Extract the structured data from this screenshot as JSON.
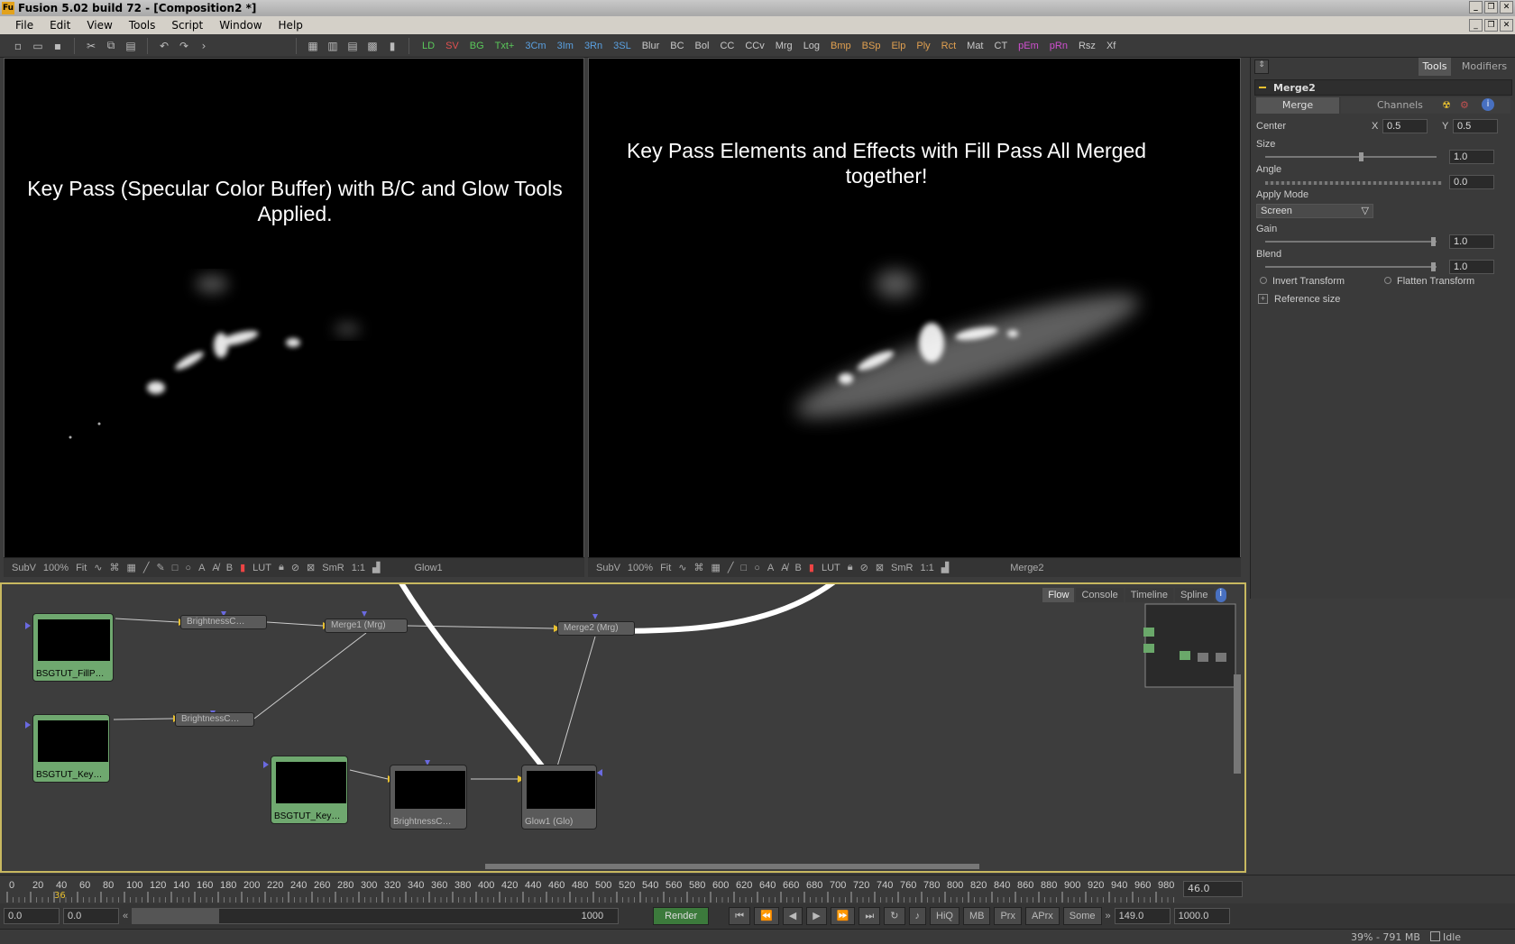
{
  "window": {
    "title": "Fusion 5.02 build 72 - [Composition2 *]",
    "icon": "Fu"
  },
  "menu": [
    "File",
    "Edit",
    "View",
    "Tools",
    "Script",
    "Window",
    "Help"
  ],
  "toolbar": {
    "tools": [
      "LD",
      "SV",
      "BG",
      "Txt+",
      "3Cm",
      "3Im",
      "3Rn",
      "3SL",
      "Blur",
      "BC",
      "Bol",
      "CC",
      "CCv",
      "Mrg",
      "Log",
      "Bmp",
      "BSp",
      "Elp",
      "Ply",
      "Rct",
      "Mat",
      "CT",
      "pEm",
      "pRn",
      "Rsz",
      "Xf"
    ],
    "tool_colors": {
      "LD": "#5ac85a",
      "SV": "#e05050",
      "BG": "#5ac85a",
      "Txt+": "#5ac85a",
      "3Cm": "#5aa0e0",
      "3Im": "#5aa0e0",
      "3Rn": "#5aa0e0",
      "3SL": "#5aa0e0",
      "Bmp": "#e0a050",
      "BSp": "#e0a050",
      "Elp": "#e0a050",
      "Ply": "#e0a050",
      "Rct": "#e0a050",
      "pEm": "#d050d0",
      "pRn": "#d050d0"
    }
  },
  "viewer_left": {
    "caption": "Key Pass (Specular Color Buffer) with B/C and Glow Tools Applied.",
    "bar": {
      "subv": "SubV",
      "zoom": "100%",
      "fit": "Fit",
      "a": "A",
      "b": "B",
      "lut": "LUT",
      "smr": "SmR",
      "ratio": "1:1",
      "view_name": "Glow1"
    }
  },
  "viewer_right": {
    "caption": "Key Pass Elements and Effects with Fill Pass All Merged together!",
    "bar": {
      "subv": "SubV",
      "zoom": "100%",
      "fit": "Fit",
      "a": "A",
      "b": "B",
      "lut": "LUT",
      "smr": "SmR",
      "ratio": "1:1",
      "view_name": "Merge2"
    }
  },
  "panel": {
    "tabs": {
      "tools": "Tools",
      "modifiers": "Modifiers"
    },
    "tool_name": "Merge2",
    "subtabs": {
      "merge": "Merge",
      "channels": "Channels"
    },
    "center": {
      "label": "Center",
      "x_label": "X",
      "x": "0.5",
      "y_label": "Y",
      "y": "0.5"
    },
    "size": {
      "label": "Size",
      "value": "1.0",
      "level": 0.5
    },
    "angle": {
      "label": "Angle",
      "value": "0.0"
    },
    "apply_mode": {
      "label": "Apply Mode",
      "value": "Screen"
    },
    "gain": {
      "label": "Gain",
      "value": "1.0",
      "level": 1.0
    },
    "blend": {
      "label": "Blend",
      "value": "1.0",
      "level": 1.0
    },
    "invert_transform": "Invert Transform",
    "flatten_transform": "Flatten Transform",
    "reference_size": "Reference size"
  },
  "flow": {
    "tabs": [
      "Flow",
      "Console",
      "Timeline",
      "Spline"
    ],
    "nodes": {
      "fill": "BSGTUT_FillP…",
      "key1": "BSGTUT_Key…",
      "key2": "BSGTUT_Key…",
      "bc1": "BrightnessC…",
      "bc2": "BrightnessC…",
      "bc3": "BrightnessC…",
      "merge1": "Merge1  (Mrg)",
      "merge2": "Merge2  (Mrg)",
      "glow": "Glow1  (Glo)"
    }
  },
  "timeline": {
    "ticks": [
      "0",
      "20",
      "40",
      "60",
      "80",
      "100",
      "120",
      "140",
      "160",
      "180",
      "200",
      "220",
      "240",
      "260",
      "280",
      "300",
      "320",
      "340",
      "360",
      "380",
      "400",
      "420",
      "440",
      "460",
      "480",
      "500",
      "520",
      "540",
      "560",
      "580",
      "600",
      "620",
      "640",
      "660",
      "680",
      "700",
      "720",
      "740",
      "760",
      "780",
      "800",
      "820",
      "840",
      "860",
      "880",
      "900",
      "920",
      "940",
      "960",
      "980"
    ],
    "current_frame": "36",
    "right_value": "46.0"
  },
  "transport": {
    "start": "0.0",
    "render_start": "0.0",
    "end_slider": "1000",
    "render": "Render",
    "hiq": "HiQ",
    "mb": "MB",
    "prx": "Prx",
    "aprx": "APrx",
    "some": "Some",
    "render_end": "149.0",
    "end": "1000.0"
  },
  "status": {
    "memory": "39% - 791 MB",
    "state": "Idle"
  }
}
